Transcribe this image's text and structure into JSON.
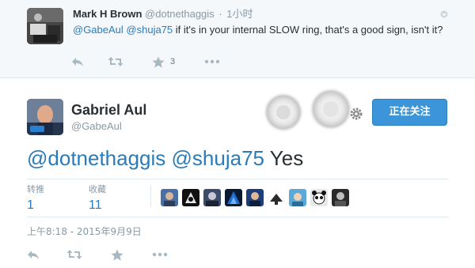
{
  "reply": {
    "name": "Mark H Brown",
    "handle": "@dotnethaggis",
    "time": "1小时",
    "mention1": "@GabeAul",
    "mention2": "@shuja75",
    "text": " if it's in your internal SLOW ring, that's a good sign, isn't it?",
    "favorite_count": "3"
  },
  "tweet": {
    "name": "Gabriel Aul",
    "handle": "@GabeAul",
    "follow_label": "正在关注",
    "mention1": "@dotnethaggis",
    "mention2": "@shuja75",
    "body": "Yes",
    "retweets_label": "转推",
    "retweets_count": "1",
    "favorites_label": "收藏",
    "favorites_count": "11",
    "timestamp": "上午8:18 - 2015年9月9日"
  },
  "favoriter_avatars": [
    "avatar-1",
    "avatar-2",
    "avatar-3",
    "avatar-4",
    "avatar-5",
    "avatar-6",
    "avatar-7",
    "avatar-8",
    "avatar-9"
  ],
  "icons": [
    "reply-icon",
    "retweet-icon",
    "favorite-icon",
    "more-icon",
    "gear-icon",
    "caret-down-icon"
  ],
  "colors": {
    "link": "#2b7bb9",
    "follow_button": "#3b95d8",
    "muted": "#8899a6",
    "reply_bg": "#f5f8fa"
  }
}
